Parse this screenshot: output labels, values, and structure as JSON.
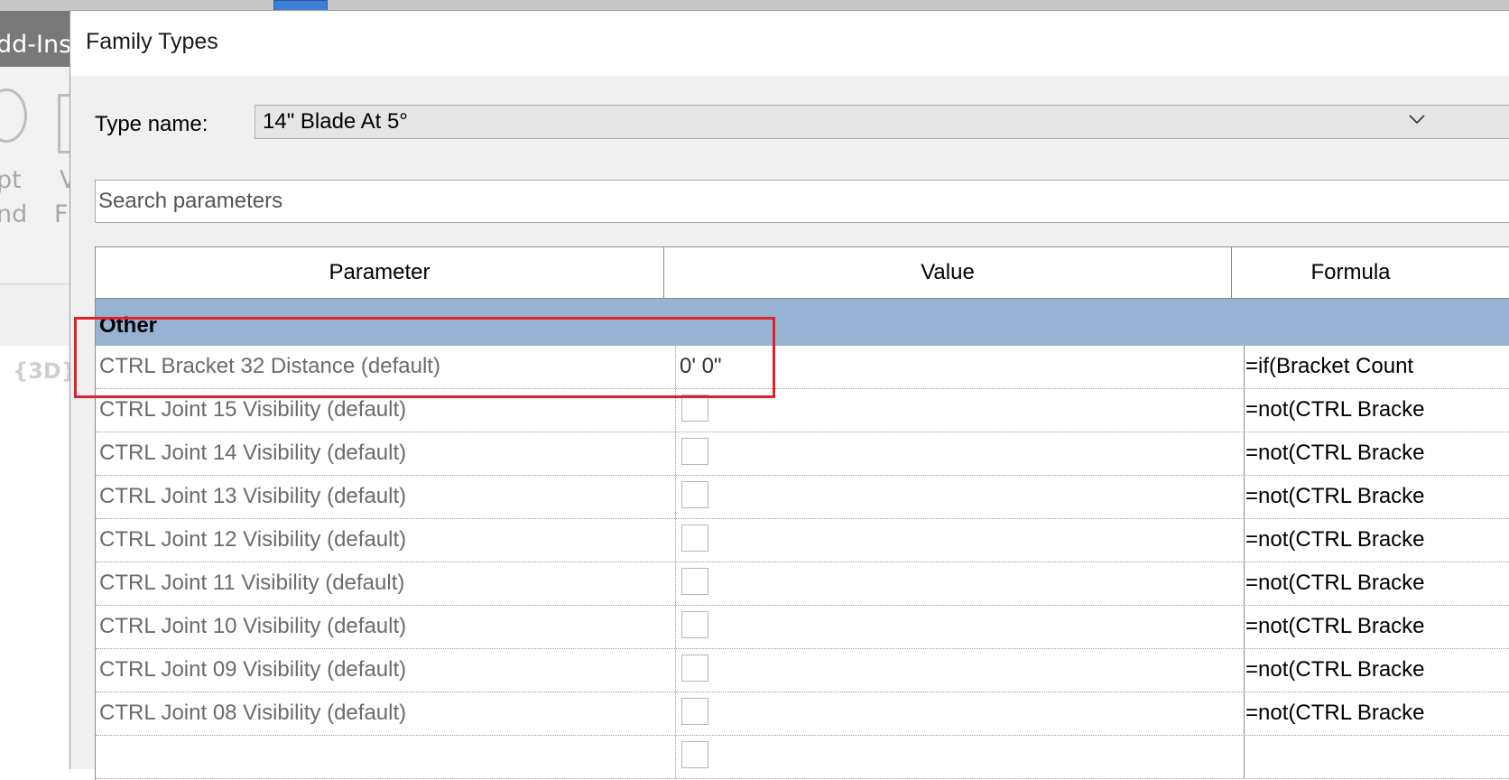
{
  "app": {
    "title_fragment": "dd-Ins",
    "ribbon_text": [
      "pt",
      "nd",
      "V",
      "F"
    ],
    "view_label": "{3D}"
  },
  "dialog": {
    "title": "Family Types",
    "type_name_label": "Type name:",
    "type_name_value": "14\" Blade At 5°",
    "search_placeholder": "Search parameters"
  },
  "grid": {
    "columns": [
      "Parameter",
      "Value",
      "Formula"
    ],
    "group": "Other",
    "rows": [
      {
        "parameter": "CTRL Bracket 32 Distance (default)",
        "value": "0'  0\"",
        "formula": "=if(Bracket Count",
        "checkbox": false
      },
      {
        "parameter": "CTRL Joint 15 Visibility (default)",
        "value": "",
        "formula": "=not(CTRL Bracke",
        "checkbox": true
      },
      {
        "parameter": "CTRL Joint 14 Visibility (default)",
        "value": "",
        "formula": "=not(CTRL Bracke",
        "checkbox": true
      },
      {
        "parameter": "CTRL Joint 13 Visibility (default)",
        "value": "",
        "formula": "=not(CTRL Bracke",
        "checkbox": true
      },
      {
        "parameter": "CTRL Joint 12 Visibility (default)",
        "value": "",
        "formula": "=not(CTRL Bracke",
        "checkbox": true
      },
      {
        "parameter": "CTRL Joint 11 Visibility (default)",
        "value": "",
        "formula": "=not(CTRL Bracke",
        "checkbox": true
      },
      {
        "parameter": "CTRL Joint 10 Visibility (default)",
        "value": "",
        "formula": "=not(CTRL Bracke",
        "checkbox": true
      },
      {
        "parameter": "CTRL Joint 09 Visibility (default)",
        "value": "",
        "formula": "=not(CTRL Bracke",
        "checkbox": true
      },
      {
        "parameter": "CTRL Joint 08 Visibility (default)",
        "value": "",
        "formula": "=not(CTRL Bracke",
        "checkbox": true
      },
      {
        "parameter": "",
        "value": "",
        "formula": "",
        "checkbox": true
      }
    ]
  },
  "colors": {
    "group_header": "#97b2d2",
    "highlight": "#e0212b"
  }
}
